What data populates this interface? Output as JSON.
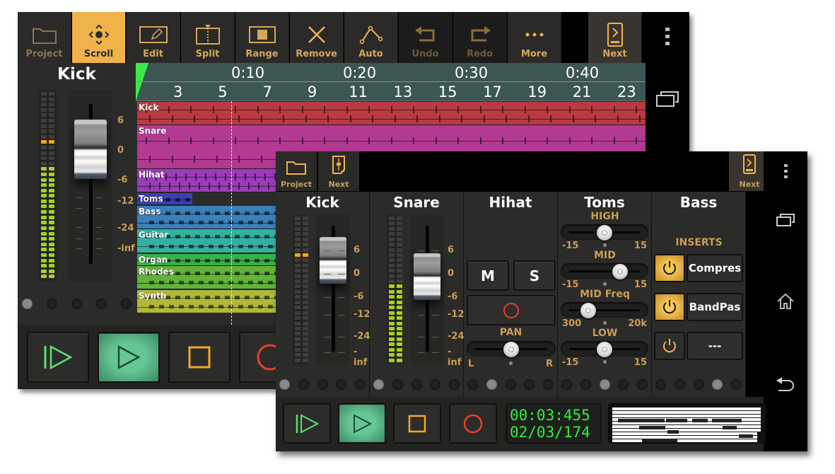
{
  "back_screen": {
    "toolbar": [
      {
        "label": "Project",
        "icon": "folder-icon",
        "state": "inactive"
      },
      {
        "label": "Scroll",
        "icon": "scroll-move-icon",
        "state": "active"
      },
      {
        "label": "Edit",
        "icon": "edit-pencil-icon",
        "state": "normal"
      },
      {
        "label": "Split",
        "icon": "split-icon",
        "state": "normal"
      },
      {
        "label": "Range",
        "icon": "range-icon",
        "state": "normal"
      },
      {
        "label": "Remove",
        "icon": "remove-x-icon",
        "state": "normal"
      },
      {
        "label": "Auto",
        "icon": "automation-icon",
        "state": "normal"
      },
      {
        "label": "Undo",
        "icon": "undo-icon",
        "state": "disabled"
      },
      {
        "label": "Redo",
        "icon": "redo-icon",
        "state": "disabled"
      },
      {
        "label": "More",
        "icon": "more-dots-icon",
        "state": "normal"
      },
      {
        "label": "Next",
        "icon": "next-screen-icon",
        "state": "normal"
      }
    ],
    "channel_strip": {
      "name": "Kick",
      "db_scale": [
        "6",
        "0",
        "-6",
        "-12",
        "-24",
        "-inf"
      ],
      "fader_db": 0,
      "meter_level_fraction": 0.6,
      "peak_indicator": "0 dB"
    },
    "ruler": {
      "time_labels": [
        "0:10",
        "0:20",
        "0:30",
        "0:40"
      ],
      "bar_labels": [
        "3",
        "5",
        "7",
        "9",
        "11",
        "13",
        "15",
        "17",
        "19",
        "21",
        "23"
      ]
    },
    "tracks": [
      {
        "name": "Kick",
        "color": "#b83b42"
      },
      {
        "name": "Snare",
        "color": "#b23a92"
      },
      {
        "name": "Hihat",
        "color": "#9a3cb8"
      },
      {
        "name": "Toms",
        "color": "#3d3eb0"
      },
      {
        "name": "Bass",
        "color": "#3a7fb8"
      },
      {
        "name": "Guitar",
        "color": "#35b0a0"
      },
      {
        "name": "Organ",
        "color": "#38b048"
      },
      {
        "name": "Rhodes",
        "color": "#62b23a"
      },
      {
        "name": "Synth",
        "color": "#b0b838"
      }
    ],
    "transport": [
      "rewind-play-icon",
      "play-icon",
      "stop-icon",
      "record-icon"
    ]
  },
  "front_screen": {
    "toolbar": [
      {
        "label": "Project",
        "icon": "folder-icon"
      },
      {
        "label": "Next",
        "icon": "mixer-next-icon"
      },
      {
        "label": "Next",
        "icon": "next-screen-icon"
      }
    ],
    "channels": [
      {
        "name": "Kick",
        "type": "fader",
        "db_scale": [
          "6",
          "0",
          "-6",
          "-12",
          "-24",
          "-inf"
        ],
        "fader_db": 0,
        "meter_level_fraction": 0.0,
        "page_dot": 1
      },
      {
        "name": "Snare",
        "type": "fader",
        "db_scale": [
          "6",
          "0",
          "-6",
          "-12",
          "-24",
          "-inf"
        ],
        "fader_db": -3,
        "meter_level_fraction": 0.52,
        "page_dot": 1
      },
      {
        "name": "Hihat",
        "type": "mute-solo",
        "mute_label": "M",
        "solo_label": "S",
        "pan_label": "PAN",
        "pan_left": "L",
        "pan_right": "R",
        "pan_value_fraction": 0.5,
        "page_dot": 2
      },
      {
        "name": "Toms",
        "type": "eq",
        "page_dot": 3,
        "bands": [
          {
            "label": "HIGH",
            "min": "-15",
            "max": "15",
            "value_fraction": 0.5
          },
          {
            "label": "MID",
            "min": "-15",
            "max": "15",
            "value_fraction": 0.78
          },
          {
            "label": "MID Freq",
            "min": "300",
            "max": "20k",
            "value_fraction": 0.2
          },
          {
            "label": "LOW",
            "min": "-15",
            "max": "15",
            "value_fraction": 0.5
          }
        ]
      },
      {
        "name": "Bass",
        "type": "inserts",
        "inserts_label": "INSERTS",
        "page_dot": 4,
        "inserts": [
          {
            "name": "Compres",
            "enabled": true
          },
          {
            "name": "BandPas",
            "enabled": true
          },
          {
            "name": "---",
            "enabled": false
          }
        ]
      }
    ],
    "transport": [
      "rewind-play-icon",
      "play-icon",
      "stop-icon",
      "record-icon"
    ],
    "time_display": {
      "time": "00:03:455",
      "position": "02/03/174"
    }
  },
  "colors": {
    "accent": "#f0b24a",
    "label_gold": "#c99d56",
    "play_green": "#66c796",
    "record_red": "#e8402a",
    "lcd_green": "#2ff03a"
  }
}
